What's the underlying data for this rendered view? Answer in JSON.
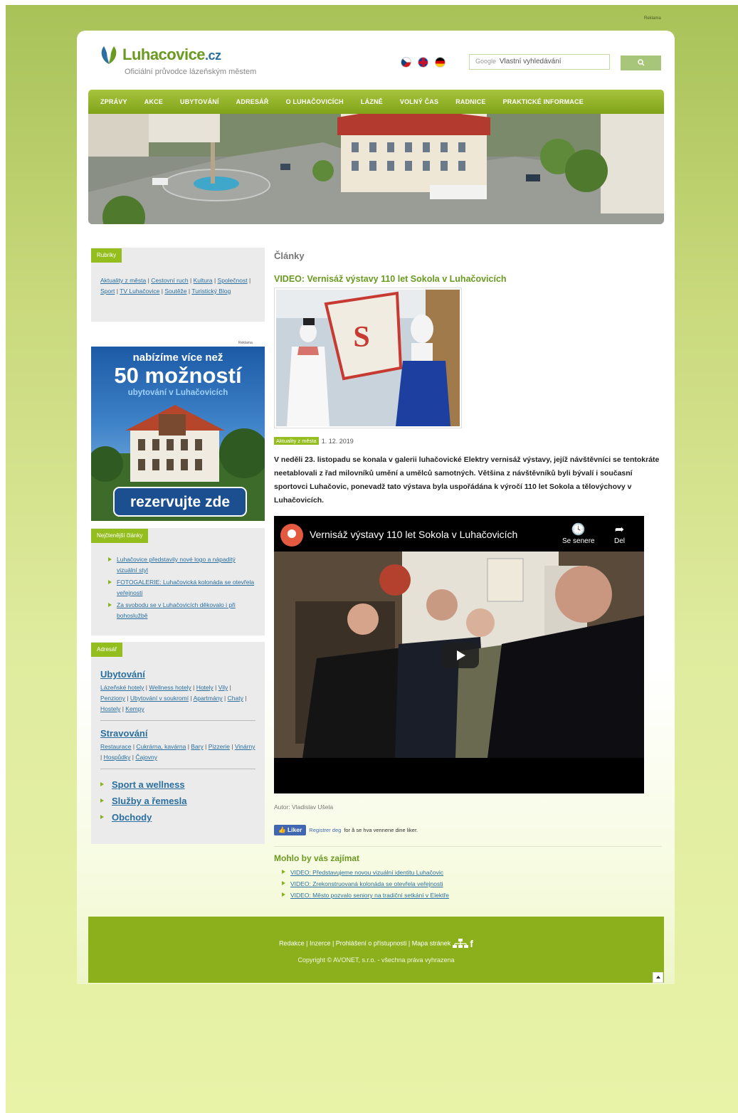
{
  "top_ad": "Reklama",
  "header": {
    "logo_main": "Luhacovice",
    "logo_tld": ".cz",
    "tagline": "Oficiální průvodce lázeňským městem",
    "languages": [
      "cz-flag-icon",
      "en-flag-icon",
      "de-flag-icon"
    ],
    "search_brand": "Google",
    "search_placeholder": "Vlastní vyhledávání",
    "search_button_icon": "search-icon"
  },
  "nav": [
    "ZPRÁVY",
    "AKCE",
    "UBYTOVÁNÍ",
    "ADRESÁŘ",
    "O LUHAČOVICÍCH",
    "LÁZNĚ",
    "VOLNÝ ČAS",
    "RADNICE",
    "PRAKTICKÉ INFORMACE"
  ],
  "sidebar": {
    "rubriky_title": "Rubriky",
    "rubriky": [
      "Aktuality z města",
      "Cestovní ruch",
      "Kultura",
      "Společnost",
      "Sport",
      "TV Luhačovice",
      "Soutěže",
      "Turistický Blog"
    ],
    "ad_label": "Reklama",
    "ad_line1": "nabízíme více než",
    "ad_line2": "50 možností",
    "ad_line3": "ubytování v Luhačovicích",
    "ad_button": "rezervujte zde",
    "popular_title": "Nejčtenější články",
    "popular": [
      "Luhačovice představily nové logo a nápaditý vizuální styl",
      "FOTOGALERIE: Luhačovická kolonáda se otevřela veřejnosti",
      "Za svobodu se v Luhačovicích děkovalo i při bohoslužbě"
    ],
    "adresar_title": "Adresář",
    "ubytovani_h": "Ubytování",
    "ubytovani": [
      "Lázeňské hotely",
      "Wellness hotely",
      "Hotely",
      "Vily",
      "Penziony",
      "Ubytování v soukromí",
      "Apartmány",
      "Chaty",
      "Hostely",
      "Kempy"
    ],
    "stravovani_h": "Stravování",
    "stravovani": [
      "Restaurace",
      "Cukrárna, kavárna",
      "Bary",
      "Pizzerie",
      "Vinárny",
      "Hospůdky",
      "Čajovny"
    ],
    "big": [
      "Sport a wellness",
      "Služby a řemesla",
      "Obchody"
    ]
  },
  "main": {
    "heading": "Články",
    "article_title": "VIDEO: Vernisáž výstavy 110 let Sokola v Luhačovicích",
    "category": "Aktuality z města",
    "date": "1. 12. 2019",
    "perex": "V neděli 23. listopadu se konala v galerii luhačovické Elektry vernisáž výstavy,  jejíž návštěvníci se tentokráte neetablovali z řad milovníků umění a umělců samotných. Většina z návštěvníků byli bývalí i současní sportovci Luhačovic, ponevadž tato výstava byla uspořádána k výročí 110 let Sokola a tělovýchovy v Luhačovicích.",
    "video_title": "Vernisáž výstavy 110 let Sokola v Luhačovicích",
    "video_watch_later": "Se senere",
    "video_share": "Del",
    "author": "Autor: Vladislav Ušela",
    "fb_like": "Liker",
    "fb_register": "Registrer deg",
    "fb_text": " for å se hva vennene dine liker.",
    "related_title": "Mohlo by vás zajímat",
    "related": [
      "VIDEO: Představujeme novou vizuální identitu Luhačovic",
      "VIDEO: Zrekonstruovaná kolonáda se otevřela veřejnosti",
      "VIDEO: Město pozvalo seniory na tradiční setkání v Elektře"
    ]
  },
  "footer": {
    "links": [
      "Redakce",
      "Inzerce",
      "Prohlášení o přístupnosti",
      "Mapa stránek"
    ],
    "copyright": "Copyright © AVONET, s.r.o. - všechna práva vyhrazena"
  },
  "colors": {
    "brand_green": "#8cb01c",
    "link_blue": "#2a6fa0",
    "accent_green_text": "#6a9a20"
  }
}
